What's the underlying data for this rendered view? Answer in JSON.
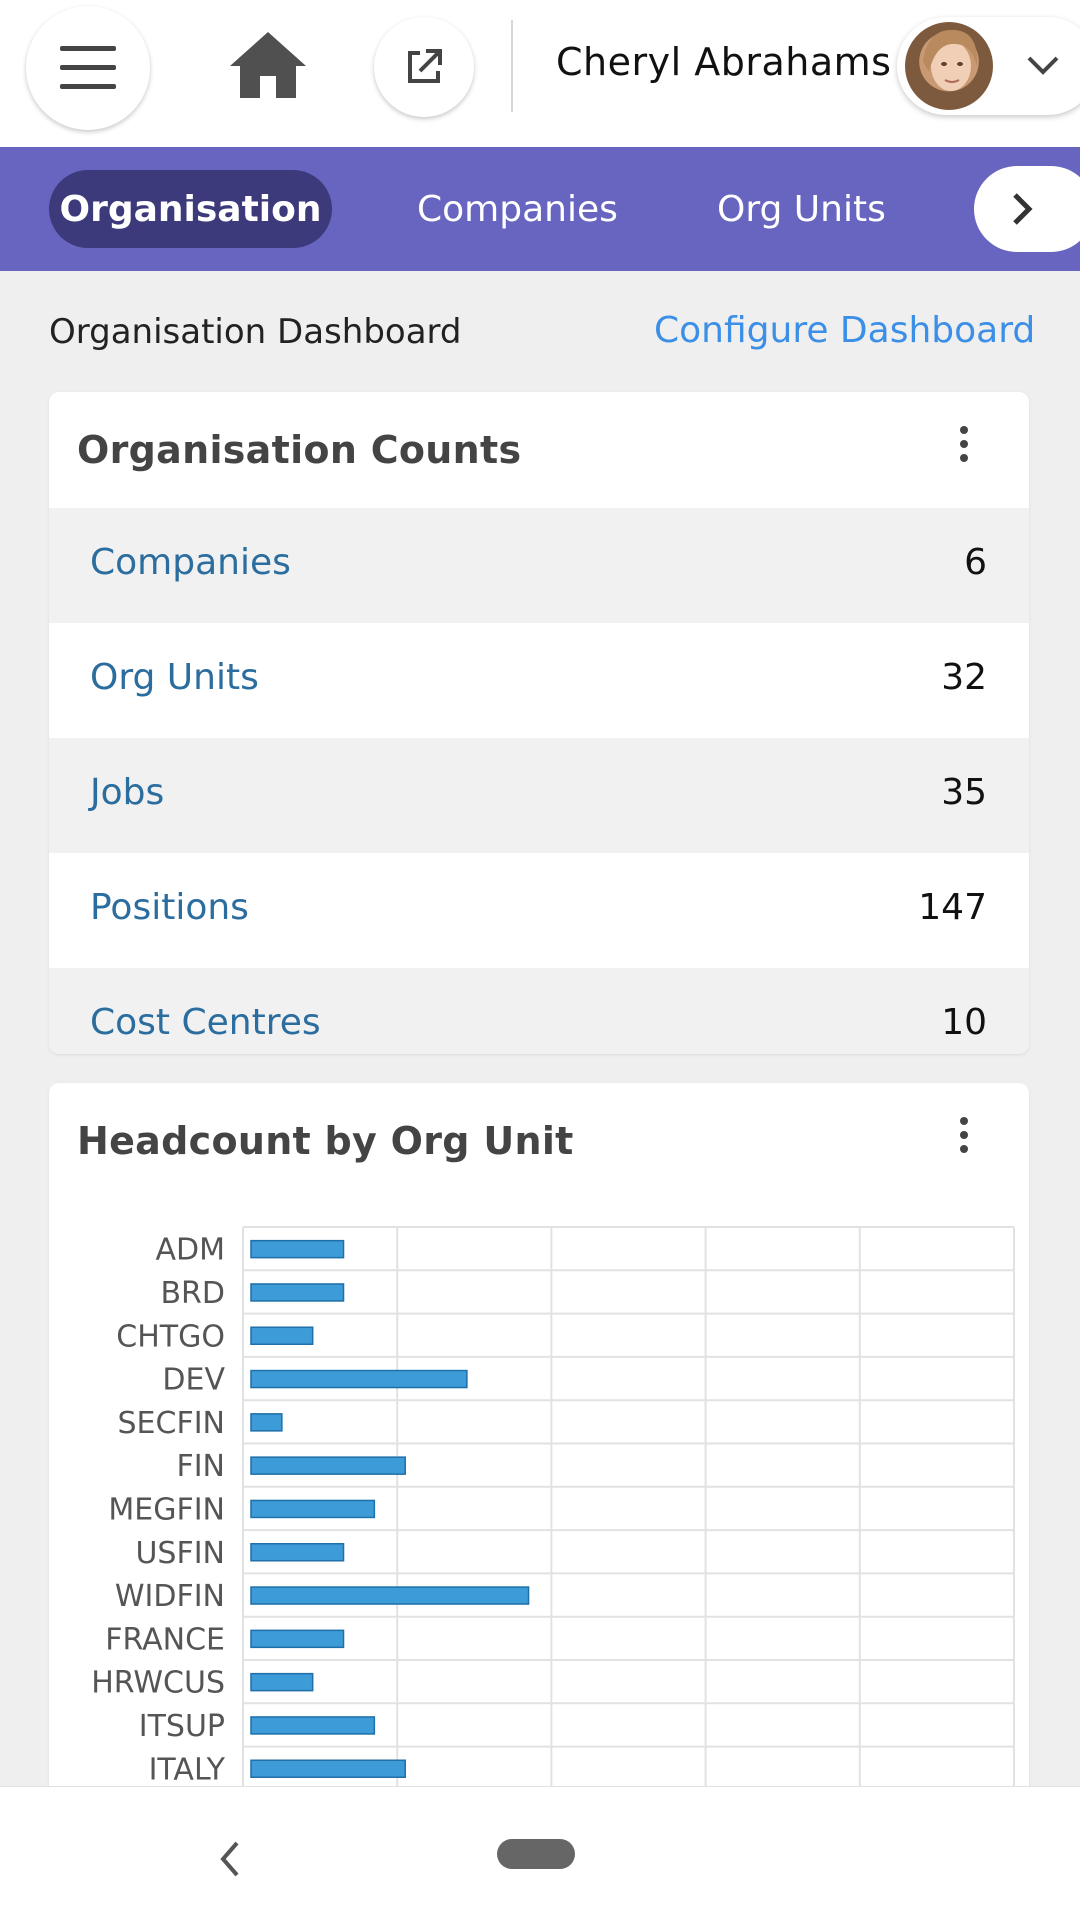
{
  "header": {
    "menu_icon": "hamburger-menu-icon",
    "home_icon": "home-icon",
    "external_icon": "open-external-icon",
    "user_name": "Cheryl Abrahams",
    "dropdown_icon": "chevron-down-icon"
  },
  "tabs": {
    "items": [
      {
        "label": "Organisation",
        "active": true
      },
      {
        "label": "Companies",
        "active": false
      },
      {
        "label": "Org Units",
        "active": false
      }
    ],
    "next_icon": "chevron-right-icon"
  },
  "dashboard": {
    "title": "Organisation Dashboard",
    "configure_label": "Configure Dashboard"
  },
  "counts_card": {
    "title": "Organisation Counts",
    "rows": [
      {
        "label": "Companies",
        "value": "6"
      },
      {
        "label": "Org Units",
        "value": "32"
      },
      {
        "label": "Jobs",
        "value": "35"
      },
      {
        "label": "Positions",
        "value": "147"
      },
      {
        "label": "Cost Centres",
        "value": "10"
      }
    ]
  },
  "headcount_card": {
    "title": "Headcount by Org Unit"
  },
  "chart_data": {
    "type": "bar",
    "orientation": "horizontal",
    "title": "Headcount by Org Unit",
    "categories": [
      "ADM",
      "BRD",
      "CHTGO",
      "DEV",
      "SECFIN",
      "FIN",
      "MEGFIN",
      "USFIN",
      "WIDFIN",
      "FRANCE",
      "HRWCUS",
      "ITSUP",
      "ITALY"
    ],
    "values": [
      3,
      3,
      2,
      7,
      1,
      5,
      4,
      3,
      9,
      3,
      2,
      4,
      5
    ],
    "xlim": [
      0,
      25
    ],
    "grid": true,
    "bar_color": "#3d9bd8"
  },
  "colors": {
    "tabbar": "#6765bf",
    "active_tab": "#3c3a7a",
    "link": "#3b8fe6",
    "count_label": "#2a6d9e"
  },
  "bottom_nav": {
    "back_icon": "back-chevron-icon",
    "home_icon": "home-pill-icon"
  }
}
